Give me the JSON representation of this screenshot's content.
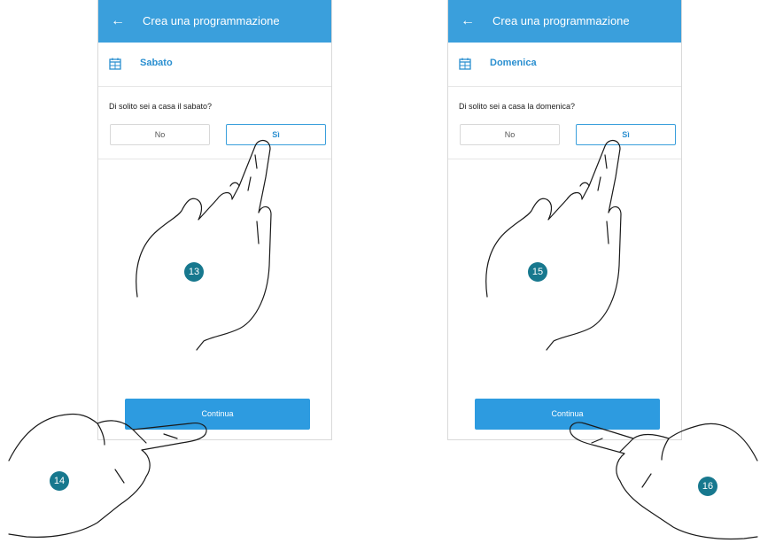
{
  "screens": [
    {
      "back_icon": "←",
      "title": "Crea una programmazione",
      "day_icon": "calendar-icon",
      "day": "Sabato",
      "question": "Di solito sei a casa il sabato?",
      "options": {
        "no": "No",
        "si": "Sì"
      },
      "continue_label": "Continua"
    },
    {
      "back_icon": "←",
      "title": "Crea una programmazione",
      "day_icon": "calendar-icon",
      "day": "Domenica",
      "question": "Di solito sei a casa la domenica?",
      "options": {
        "no": "No",
        "si": "Sì"
      },
      "continue_label": "Continua"
    }
  ],
  "step_numbers": {
    "left_top": "13",
    "left_bottom": "14",
    "right_top": "15",
    "right_bottom": "16"
  },
  "colors": {
    "header": "#3a9fdc",
    "button": "#2d9be0",
    "step_badge": "#17788e"
  }
}
